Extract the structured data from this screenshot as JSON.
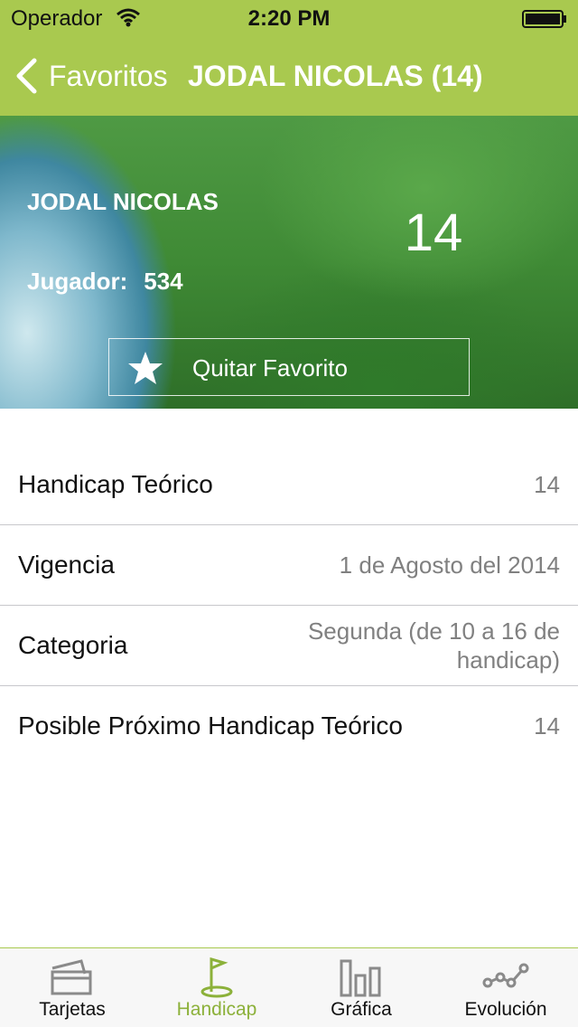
{
  "status_bar": {
    "carrier": "Operador",
    "time": "2:20 PM"
  },
  "nav": {
    "back_label": "Favoritos",
    "title": "JODAL NICOLAS (14)"
  },
  "hero": {
    "name": "JODAL NICOLAS",
    "handicap": "14",
    "player_label": "Jugador:",
    "player_number": "534",
    "favorite_button_label": "Quitar Favorito"
  },
  "details": [
    {
      "label": "Handicap Teórico",
      "value": "14"
    },
    {
      "label": "Vigencia",
      "value": "1 de Agosto del 2014"
    },
    {
      "label": "Categoria",
      "value": "Segunda (de 10 a 16 de handicap)"
    },
    {
      "label": "Posible Próximo Handicap Teórico",
      "value": "14"
    }
  ],
  "tabs": [
    {
      "label": "Tarjetas",
      "icon": "cards-icon",
      "active": false
    },
    {
      "label": "Handicap",
      "icon": "golf-flag-icon",
      "active": true
    },
    {
      "label": "Gráfica",
      "icon": "bar-chart-icon",
      "active": false
    },
    {
      "label": "Evolución",
      "icon": "line-nodes-icon",
      "active": false
    }
  ],
  "colors": {
    "accent": "#a9c94f",
    "active_tab": "#8cb13a",
    "value_text": "#808080"
  }
}
